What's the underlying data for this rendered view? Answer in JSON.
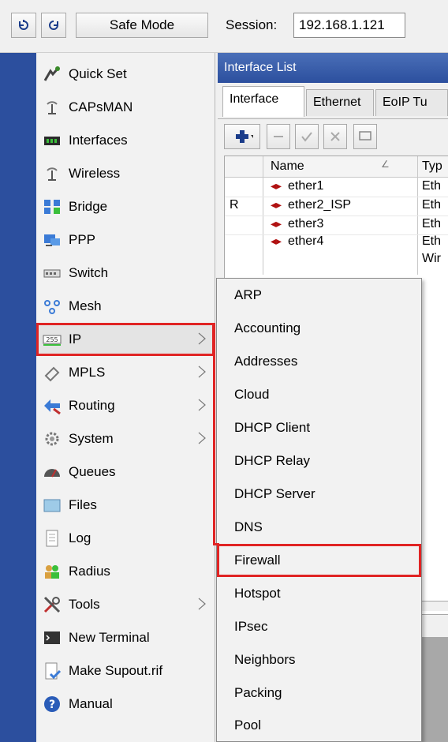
{
  "toolbar": {
    "safe_mode_label": "Safe Mode",
    "session_label": "Session:",
    "session_value": "192.168.1.121"
  },
  "sidebar": {
    "items": [
      {
        "label": "Quick Set",
        "icon": "quick-set-icon"
      },
      {
        "label": "CAPsMAN",
        "icon": "antenna-icon"
      },
      {
        "label": "Interfaces",
        "icon": "interfaces-icon"
      },
      {
        "label": "Wireless",
        "icon": "antenna-icon"
      },
      {
        "label": "Bridge",
        "icon": "bridge-icon"
      },
      {
        "label": "PPP",
        "icon": "ppp-icon"
      },
      {
        "label": "Switch",
        "icon": "switch-icon"
      },
      {
        "label": "Mesh",
        "icon": "mesh-icon"
      },
      {
        "label": "IP",
        "icon": "ip-icon"
      },
      {
        "label": "MPLS",
        "icon": "mpls-icon"
      },
      {
        "label": "Routing",
        "icon": "routing-icon"
      },
      {
        "label": "System",
        "icon": "gear-icon"
      },
      {
        "label": "Queues",
        "icon": "queues-icon"
      },
      {
        "label": "Files",
        "icon": "folder-icon"
      },
      {
        "label": "Log",
        "icon": "log-icon"
      },
      {
        "label": "Radius",
        "icon": "users-icon"
      },
      {
        "label": "Tools",
        "icon": "tools-icon"
      },
      {
        "label": "New Terminal",
        "icon": "terminal-icon"
      },
      {
        "label": "Make Supout.rif",
        "icon": "document-icon"
      },
      {
        "label": "Manual",
        "icon": "help-icon"
      }
    ]
  },
  "window": {
    "title": "Interface List",
    "tabs": [
      "Interface",
      "Ethernet",
      "EoIP Tu"
    ],
    "columns": [
      "Name",
      "Typ"
    ],
    "rows": [
      {
        "flag": "",
        "name": "ether1",
        "type": "Eth"
      },
      {
        "flag": "R",
        "name": "ether2_ISP",
        "type": "Eth"
      },
      {
        "flag": "",
        "name": "ether3",
        "type": "Eth"
      },
      {
        "flag": "",
        "name": "ether4",
        "type": "Eth"
      },
      {
        "flag": "",
        "name": "",
        "type": "Wir"
      }
    ]
  },
  "ip_menu": {
    "items": [
      "ARP",
      "Accounting",
      "Addresses",
      "Cloud",
      "DHCP Client",
      "DHCP Relay",
      "DHCP Server",
      "DNS",
      "Firewall",
      "Hotspot",
      "IPsec",
      "Neighbors",
      "Packing",
      "Pool"
    ]
  },
  "colors": {
    "strip_blue": "#2c4f9e",
    "highlight_red": "#e02424",
    "title_bar": "#3a5fab"
  }
}
